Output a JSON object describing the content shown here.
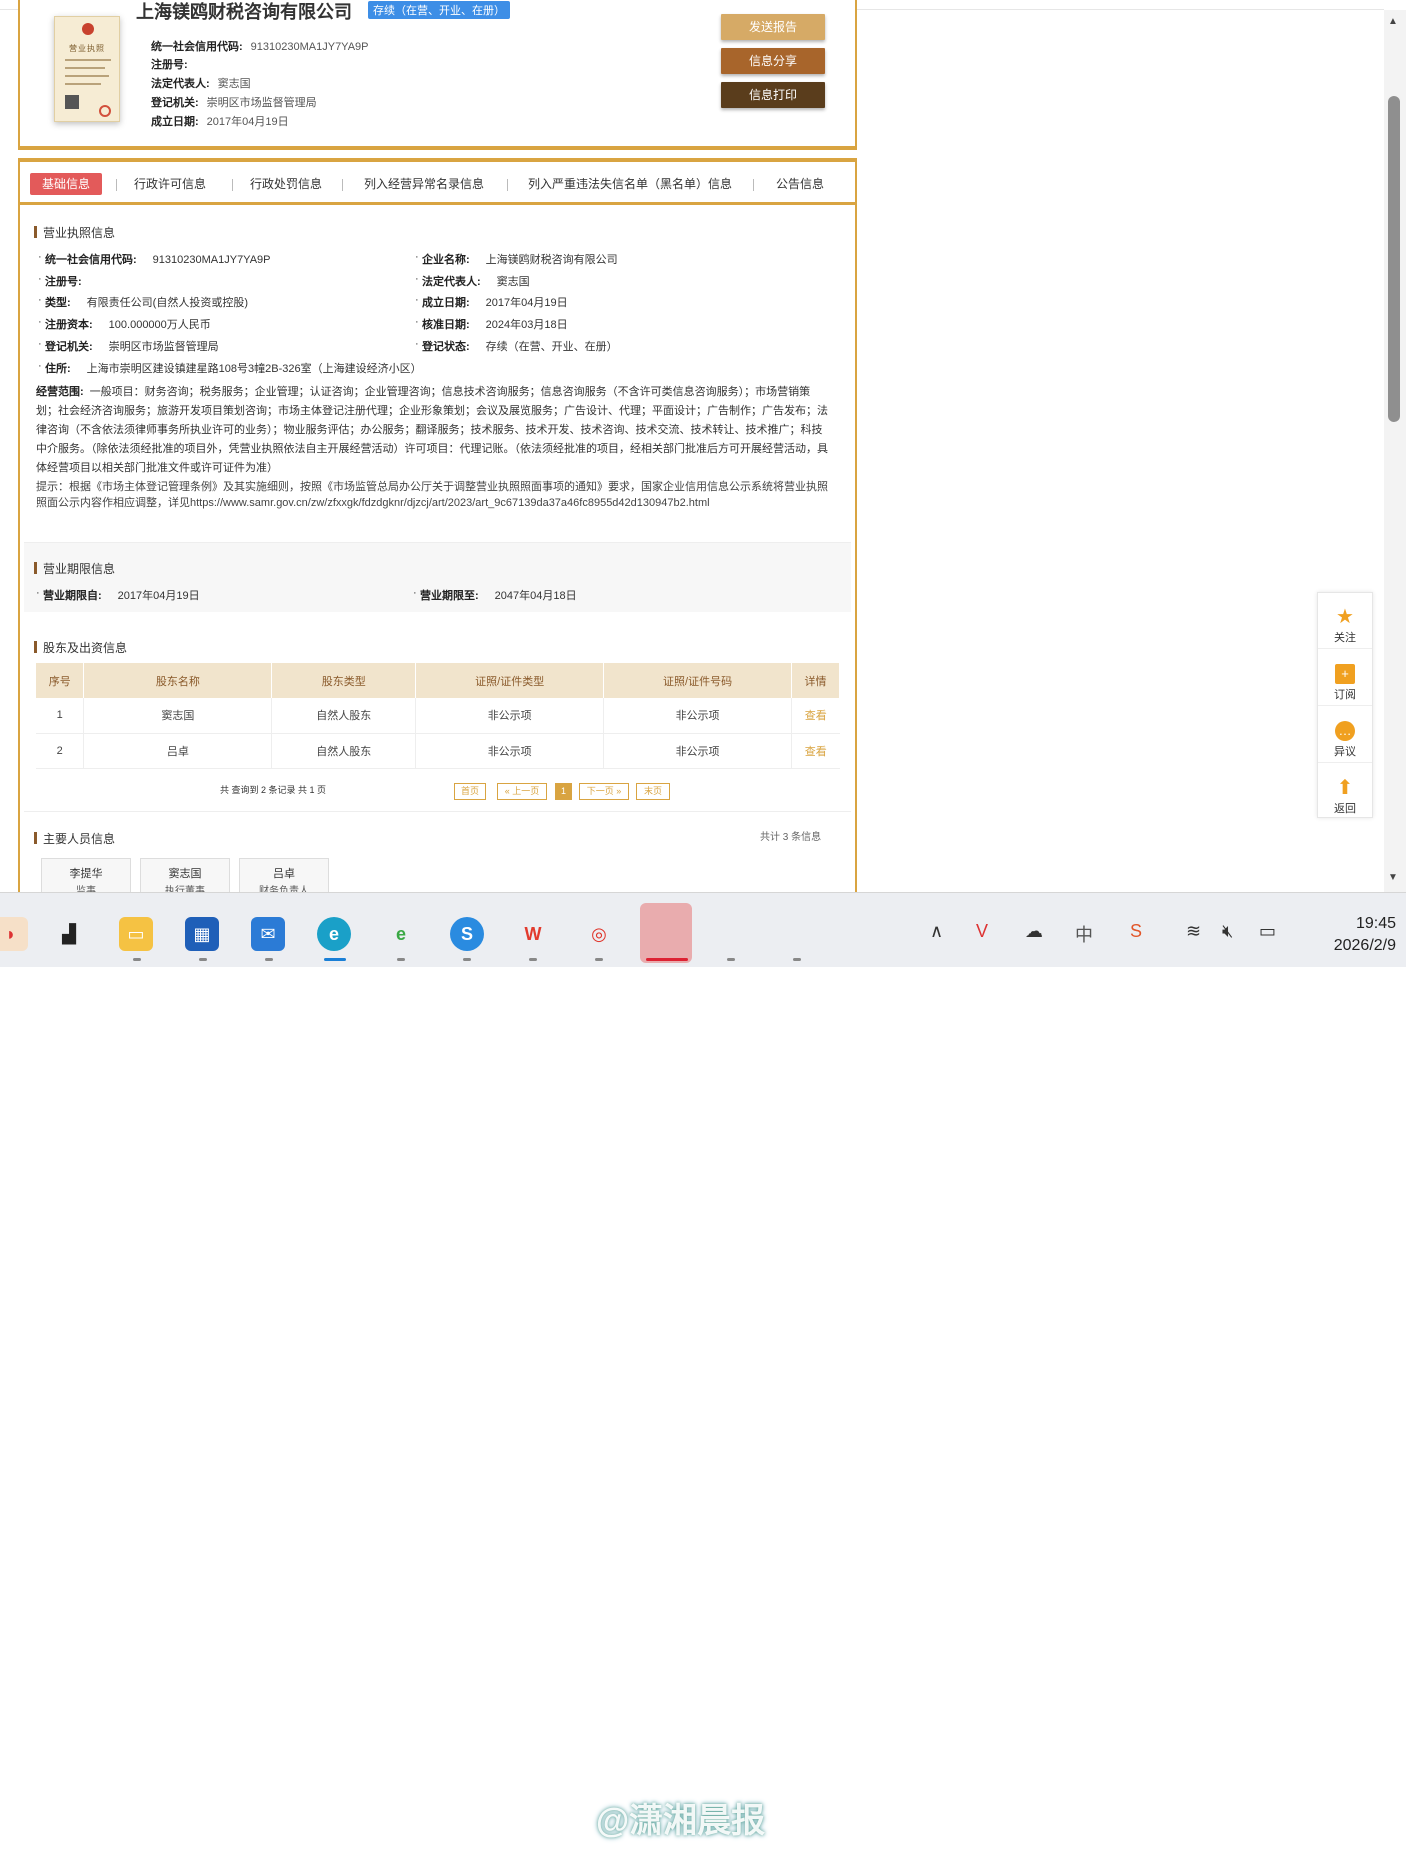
{
  "company": {
    "name": "上海镁鸥财税咨询有限公司",
    "status_badge": "存续（在营、开业、在册）",
    "license_title": "营业执照",
    "fields": [
      {
        "label": "统一社会信用代码:",
        "value": "91310230MA1JY7YA9P"
      },
      {
        "label": "注册号:",
        "value": ""
      },
      {
        "label": "法定代表人:",
        "value": "窦志国"
      },
      {
        "label": "登记机关:",
        "value": "崇明区市场监督管理局"
      },
      {
        "label": "成立日期:",
        "value": "2017年04月19日"
      }
    ]
  },
  "actions": {
    "report": "发送报告",
    "share": "信息分享",
    "print": "信息打印"
  },
  "tabs": [
    "基础信息",
    "行政许可信息",
    "行政处罚信息",
    "列入经营异常名录信息",
    "列入严重违法失信名单（黑名单）信息",
    "公告信息"
  ],
  "license_section": {
    "title": "营业执照信息",
    "left": [
      {
        "label": "统一社会信用代码:",
        "value": "91310230MA1JY7YA9P"
      },
      {
        "label": "注册号:",
        "value": ""
      },
      {
        "label": "类型:",
        "value": "有限责任公司(自然人投资或控股)"
      },
      {
        "label": "注册资本:",
        "value": "100.000000万人民币"
      },
      {
        "label": "登记机关:",
        "value": "崇明区市场监督管理局"
      }
    ],
    "right": [
      {
        "label": "企业名称:",
        "value": "上海镁鸥财税咨询有限公司"
      },
      {
        "label": "法定代表人:",
        "value": "窦志国"
      },
      {
        "label": "成立日期:",
        "value": "2017年04月19日"
      },
      {
        "label": "核准日期:",
        "value": "2024年03月18日"
      },
      {
        "label": "登记状态:",
        "value": "存续（在营、开业、在册）"
      }
    ],
    "address_label": "住所:",
    "address": "上海市崇明区建设镇建星路108号3幢2B-326室（上海建设经济小区）",
    "scope_label": "经营范围:",
    "scope": "一般项目：财务咨询；税务服务；企业管理；认证咨询；企业管理咨询；信息技术咨询服务；信息咨询服务（不含许可类信息咨询服务）；市场营销策划；社会经济咨询服务；旅游开发项目策划咨询；市场主体登记注册代理；企业形象策划；会议及展览服务；广告设计、代理；平面设计；广告制作；广告发布；法律咨询（不含依法须律师事务所执业许可的业务）；物业服务评估；办公服务；翻译服务；技术服务、技术开发、技术咨询、技术交流、技术转让、技术推广；科技中介服务。（除依法须经批准的项目外，凭营业执照依法自主开展经营活动）许可项目：代理记账。（依法须经批准的项目，经相关部门批准后方可开展经营活动，具体经营项目以相关部门批准文件或许可证件为准）",
    "hint": "提示：根据《市场主体登记管理条例》及其实施细则，按照《市场监管总局办公厅关于调整营业执照照面事项的通知》要求，国家企业信用信息公示系统将营业执照照面公示内容作相应调整，详见https://www.samr.gov.cn/zw/zfxxgk/fdzdgknr/djzcj/art/2023/art_9c67139da37a46fc8955d42d130947b2.html"
  },
  "period_section": {
    "title": "营业期限信息",
    "from_label": "营业期限自:",
    "from": "2017年04月19日",
    "to_label": "营业期限至:",
    "to": "2047年04月18日"
  },
  "shareholders": {
    "title": "股东及出资信息",
    "headers": [
      "序号",
      "股东名称",
      "股东类型",
      "证照/证件类型",
      "证照/证件号码",
      "详情"
    ],
    "rows": [
      [
        "1",
        "窦志国",
        "自然人股东",
        "非公示项",
        "非公示项",
        "查看"
      ],
      [
        "2",
        "吕卓",
        "自然人股东",
        "非公示项",
        "非公示项",
        "查看"
      ]
    ],
    "summary": "共 查询到 2 条记录 共 1 页",
    "pager": {
      "first": "首页",
      "prev": "« 上一页",
      "current": "1",
      "next": "下一页 »",
      "last": "末页"
    }
  },
  "personnel": {
    "title": "主要人员信息",
    "count": "共计 3 条信息",
    "people": [
      {
        "name": "李提华",
        "role": "监事"
      },
      {
        "name": "窦志国",
        "role": "执行董事"
      },
      {
        "name": "吕卓",
        "role": "财务负责人"
      }
    ]
  },
  "side_actions": [
    "关注",
    "订阅",
    "异议",
    "返回"
  ],
  "taskbar": {
    "watermark": "@潇湘晨报",
    "ime": "中",
    "time": "19:45",
    "date": "2026/2/9"
  },
  "colors": {
    "accent": "#d9a441",
    "active_tab": "#e35a5a",
    "badge": "#3d8ee6"
  }
}
